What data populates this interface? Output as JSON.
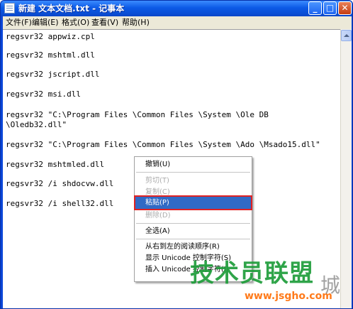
{
  "window": {
    "title": "新建 文本文档.txt - 记事本",
    "buttons": {
      "minimize": "_",
      "maximize": "□",
      "close": "✕"
    }
  },
  "menubar": [
    "文件(F)",
    "编辑(E)",
    "格式(O)",
    "查看(V)",
    "帮助(H)"
  ],
  "editor": {
    "lines": [
      "regsvr32 appwiz.cpl",
      "regsvr32 mshtml.dll",
      "regsvr32 jscript.dll",
      "regsvr32 msi.dll",
      "regsvr32 \"C:\\Program Files \\Common Files \\System \\Ole DB",
      "\\Oledb32.dll\"",
      "regsvr32 \"C:\\Program Files \\Common Files \\System \\Ado \\Msado15.dll\"",
      "regsvr32 mshtmled.dll",
      "regsvr32 /i shdocvw.dll",
      "regsvr32 /i shell32.dll"
    ]
  },
  "context_menu": {
    "items": [
      {
        "label": "撤销(U)",
        "enabled": true
      },
      {
        "label": "剪切(T)",
        "enabled": false
      },
      {
        "label": "复制(C)",
        "enabled": false
      },
      {
        "label": "粘贴(P)",
        "enabled": true,
        "selected": true
      },
      {
        "label": "删除(D)",
        "enabled": false
      },
      {
        "label": "全选(A)",
        "enabled": true
      },
      {
        "label": "从右到左的阅读顺序(R)",
        "enabled": true
      },
      {
        "label": "显示 Unicode 控制字符(S)",
        "enabled": true
      },
      {
        "label": "插入 Unicode 控制字符(I)",
        "enabled": true
      }
    ]
  },
  "watermark": {
    "main": "技术员联盟",
    "url": "www.jsgho.com",
    "seal": "城"
  },
  "colors": {
    "title_blue": "#0a46d8",
    "menu_bg": "#ece9d8",
    "highlight": "#316ac5",
    "highlight_border": "#e02222",
    "watermark_green": "#1e9d3a",
    "watermark_orange": "#ff7a1a"
  }
}
